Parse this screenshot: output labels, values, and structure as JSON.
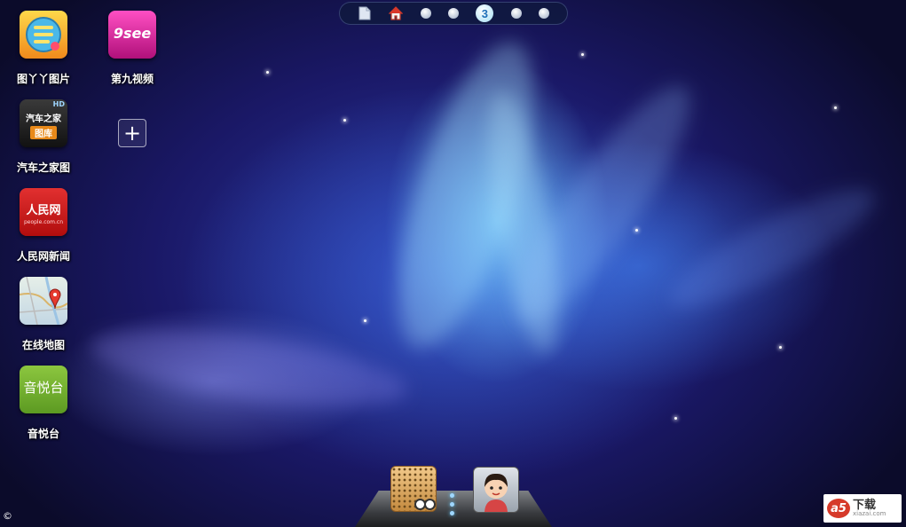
{
  "page_indicator": {
    "pages": [
      "notes-page",
      "home-page",
      "page-1",
      "page-2",
      "page-3",
      "page-4",
      "page-5"
    ],
    "current_label": "3",
    "current_index": 4
  },
  "apps": [
    {
      "id": "tuyaya",
      "label": "图丫丫图片",
      "icon": "tuyaya-icon"
    },
    {
      "id": "9see",
      "label": "第九视频",
      "icon": "9see-icon",
      "icon_text": "9see"
    },
    {
      "id": "qiche",
      "label": "汽车之家图",
      "icon": "autohome-icon",
      "icon_text_top": "汽车之家",
      "icon_text_bottom": "图库",
      "badge": "HD"
    },
    {
      "id": "people",
      "label": "人民网新闻",
      "icon": "people-icon",
      "icon_text": "人民网",
      "icon_subtext": "people.com.cn"
    },
    {
      "id": "map",
      "label": "在线地图",
      "icon": "map-icon"
    },
    {
      "id": "yinyue",
      "label": "音悦台",
      "icon": "yinyuetai-icon",
      "icon_text": "音悦台"
    }
  ],
  "add_button": {
    "label": "+"
  },
  "dock": {
    "items": [
      "speaker-icon",
      "avatar-icon"
    ]
  },
  "footer": {
    "copyright": "©"
  },
  "watermark": {
    "logo_text": "a5",
    "suffix": "下载",
    "domain": "xiazai.com"
  },
  "colors": {
    "accent": "#1d6fb8",
    "background": "#1a1866"
  }
}
